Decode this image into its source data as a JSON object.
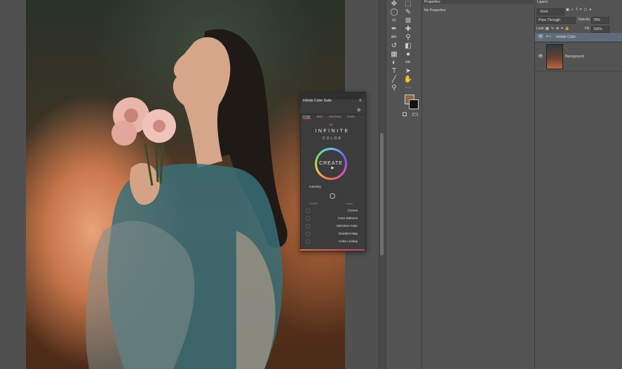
{
  "tools": {
    "icons": [
      "move-tool-icon",
      "rect-marquee-icon",
      "lasso-icon",
      "quick-select-icon",
      "crop-icon",
      "frame-icon",
      "eyedropper-icon",
      "spot-heal-icon",
      "brush-icon",
      "clone-stamp-icon",
      "history-brush-icon",
      "eraser-icon",
      "gradient-icon",
      "blur-icon",
      "dodge-icon",
      "pen-icon",
      "type-icon",
      "path-select-icon",
      "line-tool-icon",
      "hand-icon",
      "zoom-icon",
      "more-tools-icon"
    ],
    "glyphs": [
      "✥",
      "⬚",
      "◯",
      "✎",
      "⌗",
      "⊠",
      "✒",
      "✚",
      "✏",
      "⚲",
      "↺",
      "◧",
      "▦",
      "●",
      "◐",
      "✑",
      "T",
      "➤",
      "╱",
      "✋",
      "⚲",
      "⋯"
    ],
    "colors": {
      "foreground": "#8a6848",
      "background": "#111111"
    }
  },
  "properties": {
    "title": "Properties",
    "empty": "No Properties"
  },
  "layers": {
    "title": "Layers",
    "filter_kind": "Kind",
    "blend_mode": "Pass Through",
    "opacity_label": "Opacity:",
    "opacity_value": "79%",
    "lock_label": "Lock:",
    "fill_label": "Fill:",
    "fill_value": "100%",
    "items": [
      {
        "name": "Infinite Color",
        "type": "group"
      },
      {
        "name": "Background",
        "type": "image"
      }
    ]
  },
  "plugin": {
    "title": "Infinite Color Suite",
    "tabs": [
      "Color",
      "Skin",
      "Harmony",
      "Tools"
    ],
    "logo_line1": "INFINITE",
    "logo_line2": "COLOR",
    "create_label": "CREATE",
    "intensity_label": "Intensity",
    "col_shuffle": "Shuffle",
    "col_layer": "Layer",
    "adjustments": [
      "Curves",
      "Color Balance",
      "Selective Color",
      "Gradient Map",
      "Color Lookup"
    ],
    "accent": "#e2703a"
  }
}
